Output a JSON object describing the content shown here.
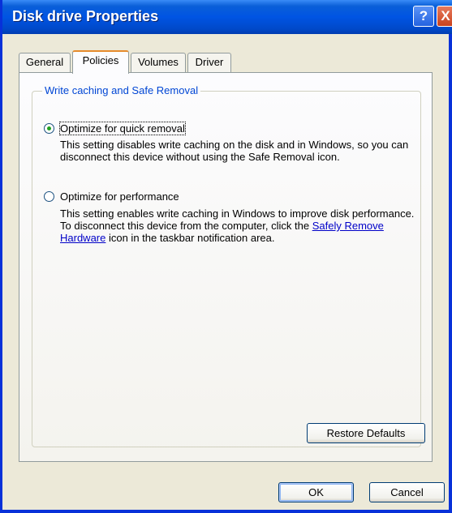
{
  "window": {
    "title": "Disk drive Properties"
  },
  "title_buttons": {
    "help": "?",
    "close": "X"
  },
  "tabs": [
    {
      "label": "General"
    },
    {
      "label": "Policies"
    },
    {
      "label": "Volumes"
    },
    {
      "label": "Driver"
    }
  ],
  "active_tab": "Policies",
  "group": {
    "title": "Write caching and Safe Removal",
    "options": [
      {
        "label": "Optimize for quick removal",
        "selected": true,
        "description": "This setting disables write caching on the disk and in Windows, so you can disconnect this device without using the Safe Removal icon."
      },
      {
        "label": "Optimize for performance",
        "selected": false,
        "description_before_link": "This setting enables write caching in Windows to improve disk performance. To disconnect this device from the computer, click the ",
        "link": "Safely Remove Hardware",
        "description_after_link": " icon in the taskbar notification area."
      }
    ]
  },
  "buttons": {
    "restore_defaults": "Restore Defaults",
    "ok": "OK",
    "cancel": "Cancel"
  },
  "colors": {
    "title_bar": "#0054e3",
    "group_title": "#0046d5",
    "radio_dot": "#21a121",
    "link": "#0000c8"
  }
}
